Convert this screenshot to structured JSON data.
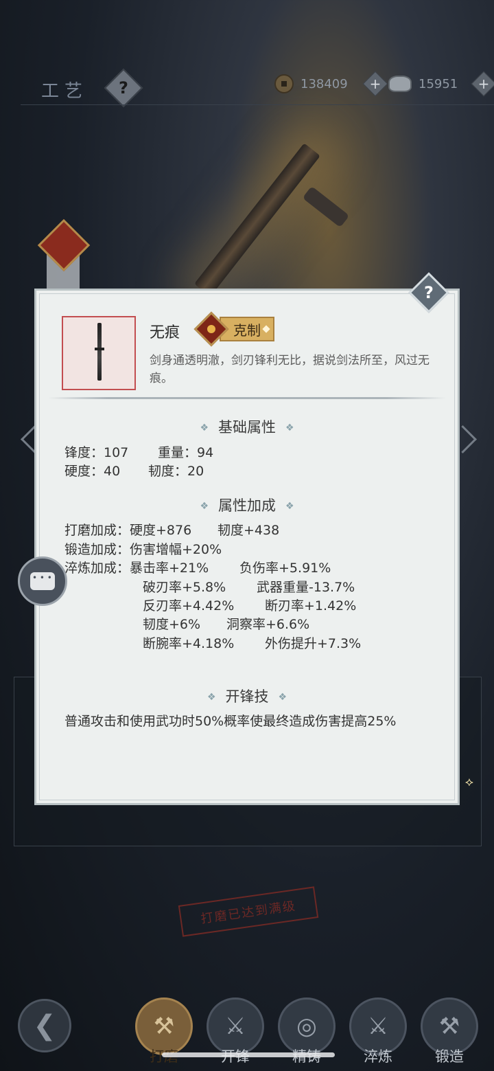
{
  "header": {
    "title": "工艺",
    "help_symbol": "?",
    "copper": "138409",
    "silver": "15951",
    "plus_symbol": "+"
  },
  "item": {
    "name": "无痕",
    "counter_label": "克制",
    "description": "剑身通透明澈，剑刃锋利无比，据说剑法所至，风过无痕。",
    "help_symbol": "?"
  },
  "base_attributes": {
    "title": "基础属性",
    "rows": [
      [
        "锋度：107",
        "重量：94"
      ],
      [
        "硬度：40",
        "韧度：20"
      ]
    ]
  },
  "attribute_bonus": {
    "title": "属性加成",
    "polish": {
      "label": "打磨加成：",
      "values": [
        "硬度+876",
        "韧度+438"
      ]
    },
    "forge": {
      "label": "锻造加成：",
      "values": [
        "伤害增幅+20%"
      ]
    },
    "temper": {
      "label": "淬炼加成：",
      "rows": [
        [
          "暴击率+21%",
          "负伤率+5.91%"
        ],
        [
          "破刃率+5.8%",
          "武器重量-13.7%"
        ],
        [
          "反刃率+4.42%",
          "断刃率+1.42%"
        ],
        [
          "韧度+6%",
          "洞察率+6.6%"
        ],
        [
          "断腕率+4.18%",
          "外伤提升+7.3%"
        ]
      ]
    }
  },
  "edge_skill": {
    "title": "开锋技",
    "description": "普通攻击和使用武功时50%概率使最终造成伤害提高25%"
  },
  "stamp_text": "打磨已达到满级",
  "bottom_nav": {
    "back_symbol": "❮",
    "tabs": [
      {
        "label": "打磨",
        "icon": "polish-icon",
        "active": true
      },
      {
        "label": "开锋",
        "icon": "sharpen-icon",
        "active": false
      },
      {
        "label": "精铸",
        "icon": "refine-icon",
        "active": false
      },
      {
        "label": "淬炼",
        "icon": "temper-icon",
        "active": false
      },
      {
        "label": "锻造",
        "icon": "forge-icon",
        "active": false
      }
    ]
  },
  "diamond_symbol": "❖"
}
